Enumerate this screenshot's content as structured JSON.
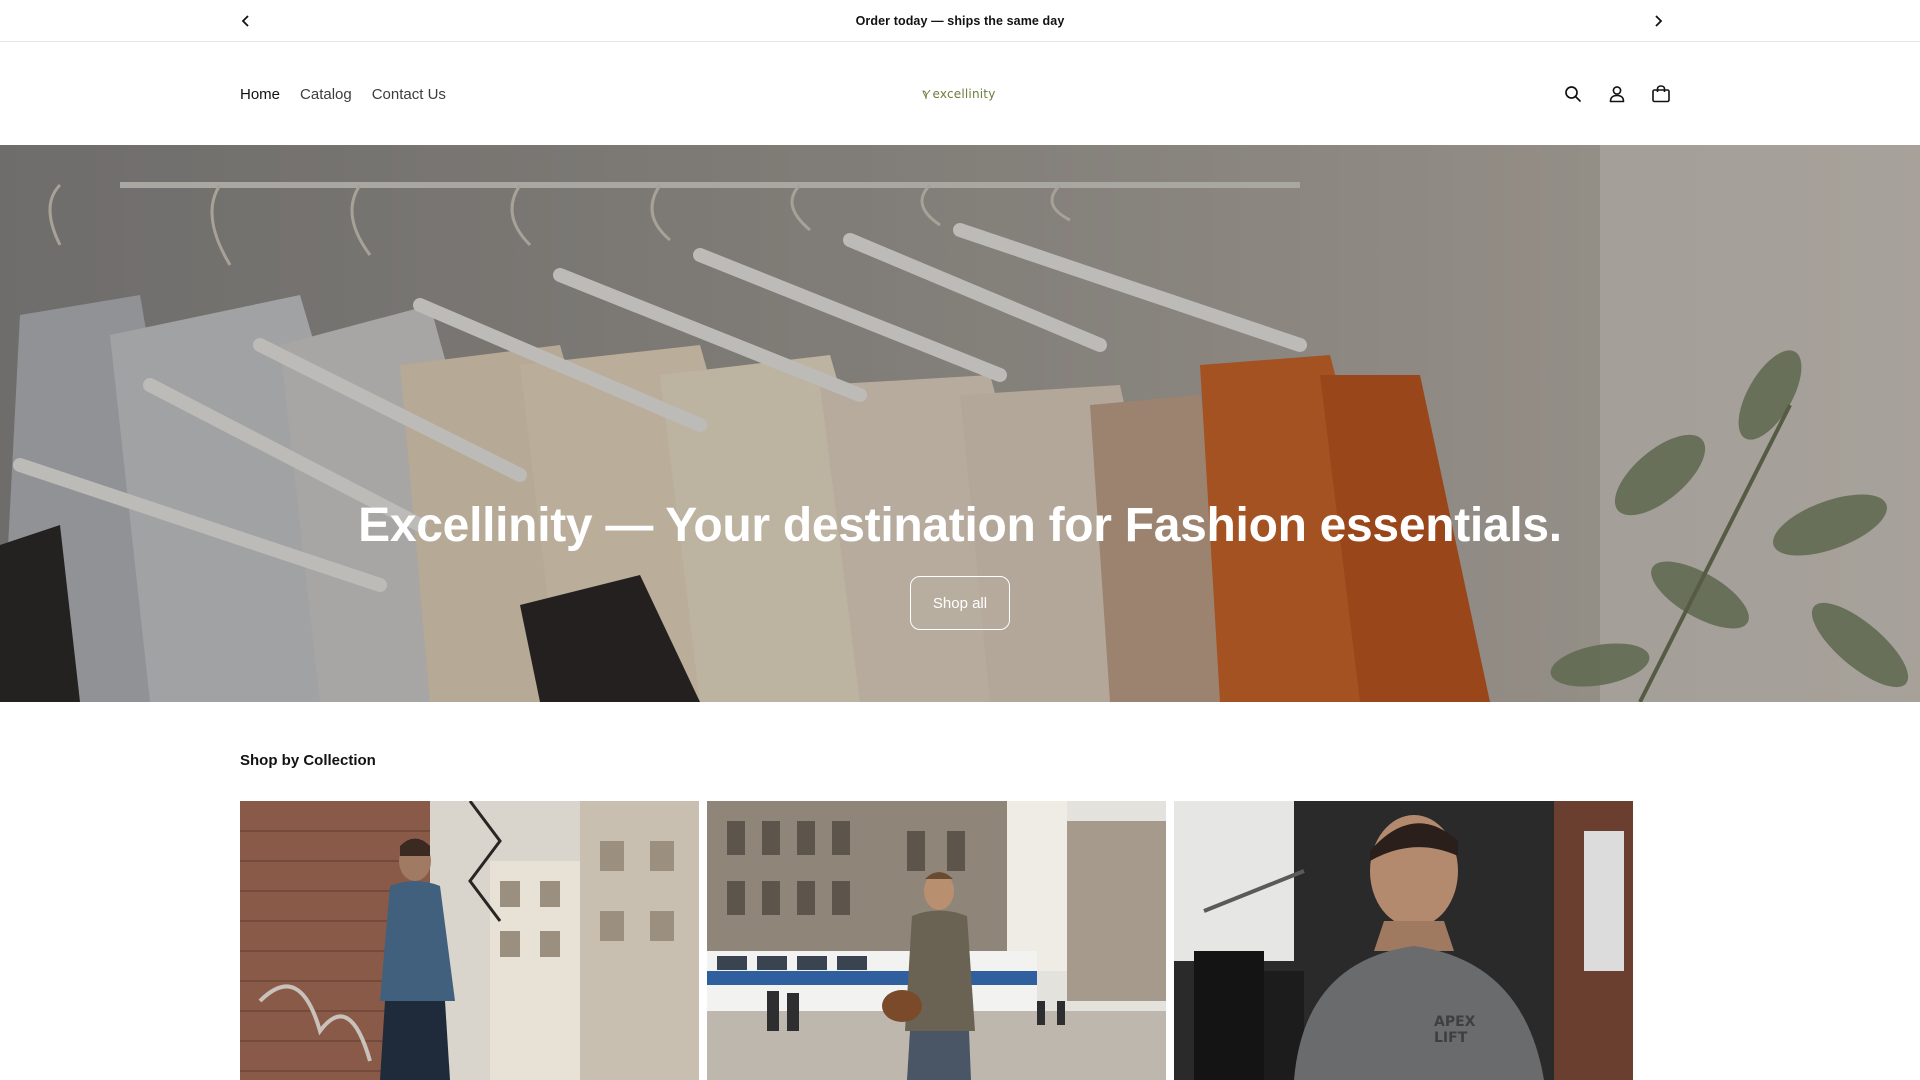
{
  "announcement": {
    "text": "Order today — ships the same day",
    "prev_icon": "chevron-left-icon",
    "next_icon": "chevron-right-icon"
  },
  "header": {
    "nav": [
      {
        "label": "Home",
        "active": true
      },
      {
        "label": "Catalog",
        "active": false
      },
      {
        "label": "Contact Us",
        "active": false
      }
    ],
    "logo_text": "excellinity",
    "icons": [
      "search-icon",
      "account-icon",
      "cart-icon"
    ]
  },
  "hero": {
    "title": "Excellinity — Your destination for Fashion essentials.",
    "button_label": "Shop all"
  },
  "collections": {
    "title": "Shop by Collection",
    "cards": [
      {
        "image": "man-denim-jacket-brick-alley"
      },
      {
        "image": "man-city-street-tram"
      },
      {
        "image": "man-gym-grey-tshirt"
      }
    ]
  },
  "colors": {
    "logo_green": "#6c7d3c",
    "text": "#121212",
    "border": "#e6e6e6"
  }
}
